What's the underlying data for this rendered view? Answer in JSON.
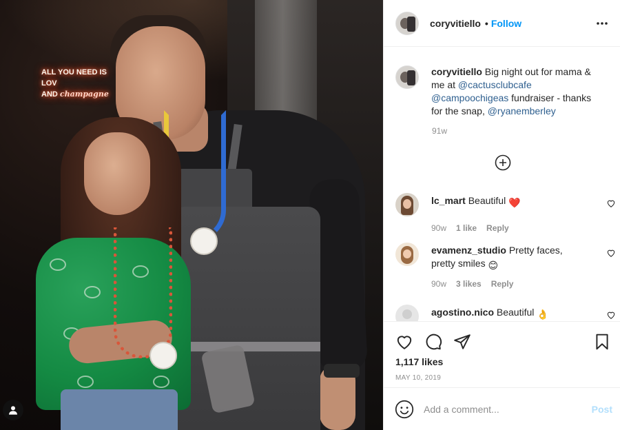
{
  "photo": {
    "neon_line1": "ALL YOU NEED IS LOV",
    "neon_line2_prefix": "AND ",
    "neon_line2_script": "champagne",
    "user_tag_icon": "person-icon"
  },
  "header": {
    "avatar_icon": "profile-avatar",
    "username": "coryvitiello",
    "separator": "•",
    "follow_label": "Follow",
    "more_icon": "more-horizontal-icon"
  },
  "caption": {
    "username": "coryvitiello",
    "text_before": " Big night out for mama & me at ",
    "mention1": "@cactusclubcafe",
    "mention2": "@campoochigeas",
    "text_middle": " fundraiser - thanks for the snap, ",
    "mention3": "@ryanemberley",
    "time": "91w"
  },
  "load_more_icon": "plus-circle-icon",
  "comments": [
    {
      "username": "lc_mart",
      "text": " Beautiful ",
      "emoji": "❤️",
      "time": "90w",
      "likes": "1 like",
      "reply": "Reply"
    },
    {
      "username": "evamenz_studio",
      "text": " Pretty faces, pretty smiles ",
      "emoji": "😊",
      "time": "90w",
      "likes": "3 likes",
      "reply": "Reply"
    },
    {
      "username": "agostino.nico",
      "text": " Beautiful ",
      "emoji": "👌"
    }
  ],
  "actions": {
    "like_icon": "heart-icon",
    "comment_icon": "comment-icon",
    "share_icon": "paper-plane-icon",
    "save_icon": "bookmark-icon",
    "likes": "1,117 likes",
    "date": "MAY 10, 2019"
  },
  "add_comment": {
    "emoji_icon": "smiley-icon",
    "placeholder": "Add a comment...",
    "post_label": "Post"
  },
  "colors": {
    "link_blue": "#0095f6",
    "mention": "#2e5f8f",
    "muted": "#8e8e8e",
    "post_disabled": "#b2dffc",
    "heart_red": "#ed4956"
  }
}
